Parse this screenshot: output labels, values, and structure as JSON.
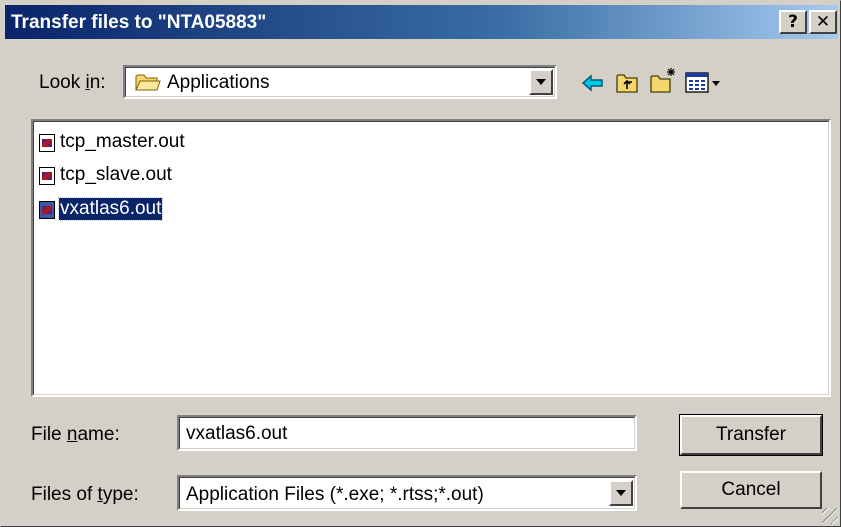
{
  "window": {
    "title": "Transfer files to \"NTA05883\"",
    "help_label": "?",
    "close_label": "✕"
  },
  "lookin": {
    "label_pre": "Look ",
    "label_key": "i",
    "label_post": "n:",
    "value": "Applications"
  },
  "files": [
    {
      "name": "tcp_master.out"
    },
    {
      "name": "tcp_slave.out"
    },
    {
      "name": "vxatlas6.out"
    }
  ],
  "filename": {
    "label_pre": "File ",
    "label_key": "n",
    "label_post": "ame:",
    "value": "vxatlas6.out"
  },
  "filetype": {
    "label_pre": "Files of ",
    "label_key": "t",
    "label_post": "ype:",
    "value": "Application Files (*.exe; *.rtss;*.out)"
  },
  "buttons": {
    "transfer": "Transfer",
    "cancel": "Cancel"
  },
  "icons": [
    "folder-icon",
    "back-arrow-icon",
    "up-folder-icon",
    "new-folder-icon",
    "view-menu-icon"
  ],
  "colors": {
    "title_start": "#0a246a",
    "title_end": "#a6caf0",
    "selection": "#0a246a",
    "face": "#d4d0c8"
  }
}
